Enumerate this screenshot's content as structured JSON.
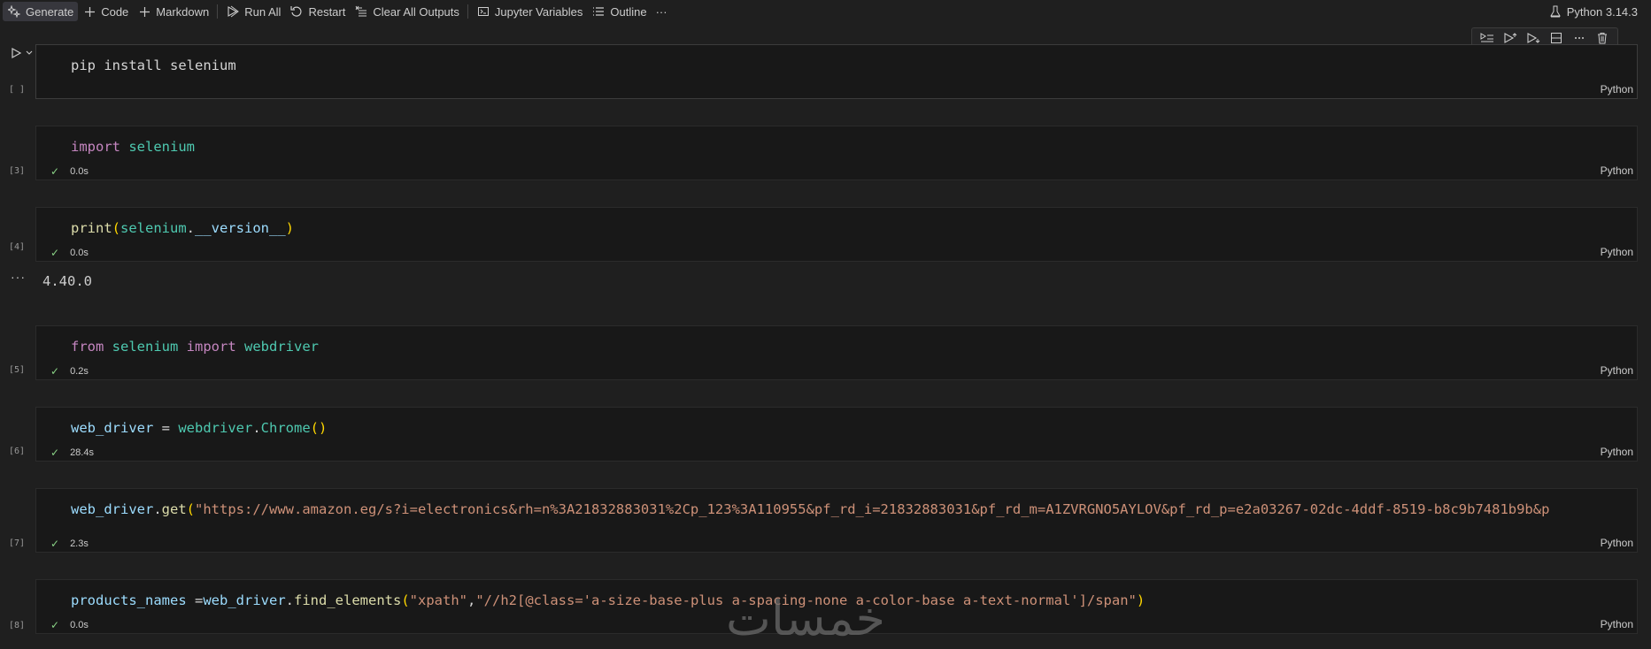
{
  "toolbar": {
    "generate": "Generate",
    "code": "Code",
    "markdown": "Markdown",
    "run_all": "Run All",
    "restart": "Restart",
    "clear_outputs": "Clear All Outputs",
    "variables": "Jupyter Variables",
    "outline": "Outline",
    "more": "···",
    "kernel": "Python 3.14.3"
  },
  "cell_toolbar_icons": [
    "run-by-line-icon",
    "execute-above-icon",
    "execute-below-icon",
    "split-cell-icon",
    "more-icon",
    "delete-icon"
  ],
  "cells": [
    {
      "exec": "[ ]",
      "lang": "Python",
      "time": ""
    },
    {
      "exec": "[3]",
      "lang": "Python",
      "time": "0.0s"
    },
    {
      "exec": "[4]",
      "lang": "Python",
      "time": "0.0s"
    },
    {
      "exec": "[5]",
      "lang": "Python",
      "time": "0.2s"
    },
    {
      "exec": "[6]",
      "lang": "Python",
      "time": "28.4s"
    },
    {
      "exec": "[7]",
      "lang": "Python",
      "time": "2.3s"
    },
    {
      "exec": "[8]",
      "lang": "Python",
      "time": "0.0s"
    }
  ],
  "code": {
    "c1": {
      "pip": "pip",
      "install": "install",
      "selenium": "selenium"
    },
    "c2": {
      "import": "import",
      "module": "selenium"
    },
    "c3": {
      "print": "print",
      "lparen": "(",
      "module": "selenium",
      "dot": ".",
      "attr": "__version__",
      "rparen": ")"
    },
    "c4": {
      "from": "from",
      "module": "selenium",
      "import": "import",
      "name": "webdriver"
    },
    "c5": {
      "var": "web_driver",
      "eq": " = ",
      "module": "webdriver",
      "dot": ".",
      "cls": "Chrome",
      "parens": "()"
    },
    "c6": {
      "var": "web_driver",
      "dot": ".",
      "method": "get",
      "lparen": "(",
      "url": "\"https://www.amazon.eg/s?i=electronics&rh=n%3A21832883031%2Cp_123%3A110955&pf_rd_i=21832883031&pf_rd_m=A1ZVRGNO5AYLOV&pf_rd_p=e2a03267-02dc-4ddf-8519-b8c9b7481b9b&p"
    },
    "c7": {
      "var": "products_names",
      "eq": " =",
      "obj": "web_driver",
      "dot": ".",
      "method": "find_elements",
      "lparen": "(",
      "arg1": "\"xpath\"",
      "comma": ",",
      "arg2": "\"//h2[@class='a-size-base-plus a-spacing-none a-color-base a-text-normal']/span\"",
      "rparen": ")"
    }
  },
  "output_c3": "4.40.0",
  "output_dots": "···",
  "watermark": "خمسات"
}
